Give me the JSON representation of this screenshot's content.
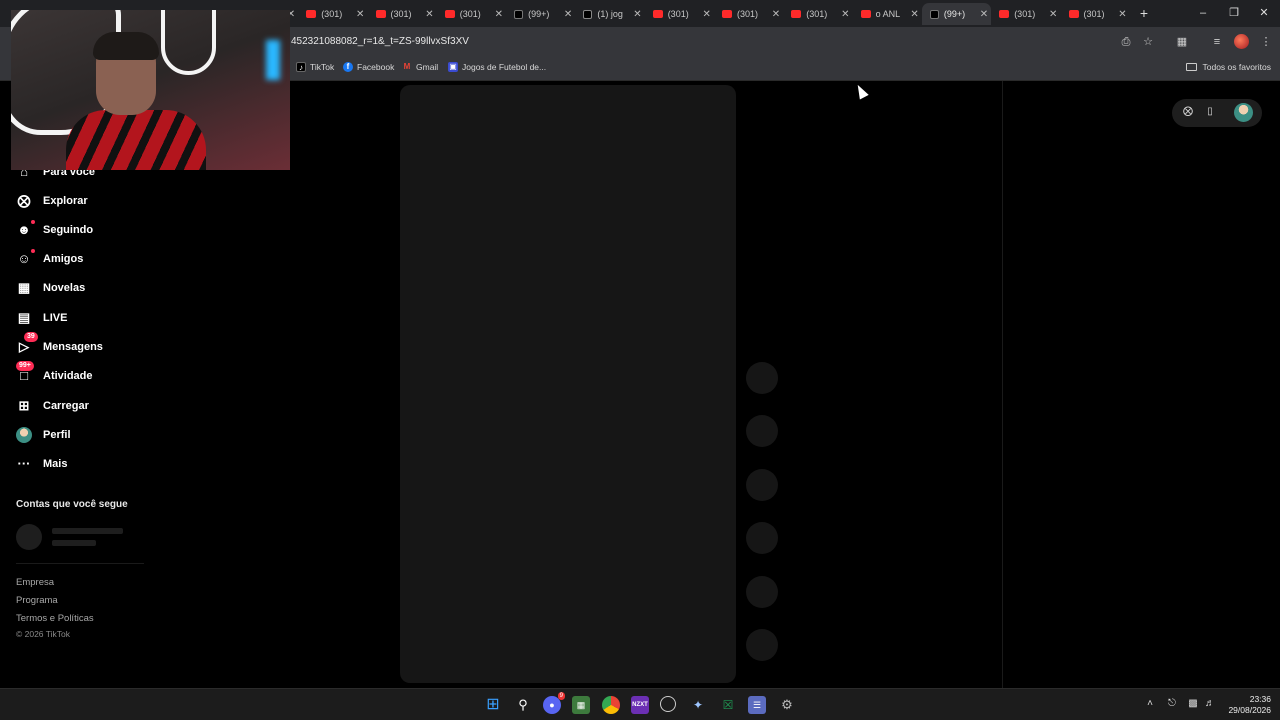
{
  "browser": {
    "tabs": [
      {
        "title": "(301)",
        "favicon": "youtube"
      },
      {
        "title": "(301)",
        "favicon": "youtube"
      },
      {
        "title": "(301)",
        "favicon": "youtube"
      },
      {
        "title": "(301)",
        "favicon": "youtube"
      },
      {
        "title": "(301)",
        "favicon": "youtube"
      },
      {
        "title": "(301)",
        "favicon": "youtube"
      },
      {
        "title": "(301)",
        "favicon": "youtube"
      },
      {
        "title": "(99+)",
        "favicon": "tiktok"
      },
      {
        "title": "(1) jog",
        "favicon": "x"
      },
      {
        "title": "(301)",
        "favicon": "youtube"
      },
      {
        "title": "(301)",
        "favicon": "youtube"
      },
      {
        "title": "(301)",
        "favicon": "youtube"
      },
      {
        "title": "o ANL",
        "favicon": "youtube"
      },
      {
        "title": "(99+)",
        "favicon": "tiktok",
        "active": true
      },
      {
        "title": "(301)",
        "favicon": "youtube"
      },
      {
        "title": "(301)",
        "favicon": "youtube"
      }
    ],
    "new_tab_label": "+",
    "url": "452321088082_r=1&_t=ZS-99llvxSf3XV",
    "bookmarks": [
      {
        "label": "TikTok",
        "icon": "tiktok-icon"
      },
      {
        "label": "Facebook",
        "icon": "facebook-icon"
      },
      {
        "label": "Gmail",
        "icon": "gmail-icon"
      },
      {
        "label": "Jogos de Futebol de...",
        "icon": "games-icon"
      }
    ],
    "all_bookmarks_label": "Todos os favoritos"
  },
  "sidebar": {
    "items": [
      {
        "label": "Para você",
        "icon": "home-icon"
      },
      {
        "label": "Explorar",
        "icon": "compass-icon"
      },
      {
        "label": "Seguindo",
        "icon": "following-icon",
        "dot": true
      },
      {
        "label": "Amigos",
        "icon": "friends-icon",
        "dot": true
      },
      {
        "label": "Novelas",
        "icon": "film-icon"
      },
      {
        "label": "LIVE",
        "icon": "live-icon"
      },
      {
        "label": "Mensagens",
        "icon": "messages-icon",
        "badge": "39"
      },
      {
        "label": "Atividade",
        "icon": "activity-icon",
        "badge": "99+"
      },
      {
        "label": "Carregar",
        "icon": "upload-icon"
      },
      {
        "label": "Perfil",
        "icon": "profile-icon"
      },
      {
        "label": "Mais",
        "icon": "more-icon"
      }
    ],
    "following_title": "Contas que você segue",
    "footer": [
      "Empresa",
      "Programa",
      "Termos e Políticas"
    ],
    "copyright": "© 2026 TikTok"
  },
  "taskbar": {
    "time": "23:36",
    "date": "29/08/2026",
    "discord_badge": "9",
    "nzxt_label": "NZXT"
  },
  "colors": {
    "accent": "#fe2c55",
    "background": "#000000",
    "skeleton": "#161616"
  }
}
